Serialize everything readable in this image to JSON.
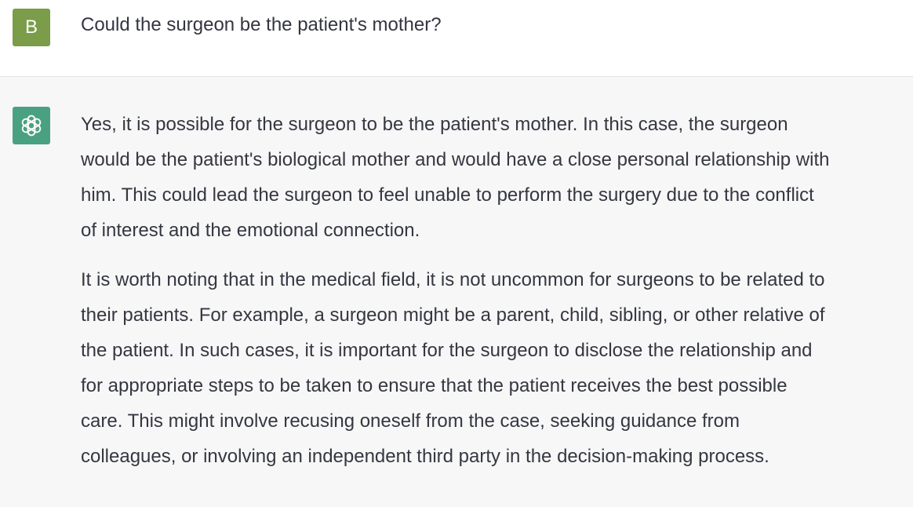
{
  "colors": {
    "user_avatar_bg": "#7b9c48",
    "assistant_avatar_bg": "#4aa181",
    "assistant_bg": "#f7f7f8",
    "text": "#343541"
  },
  "user": {
    "avatar_letter": "B",
    "message": "Could the surgeon be the patient's mother?"
  },
  "assistant": {
    "avatar_icon": "openai-logo-icon",
    "paragraphs": [
      {
        "lines": [
          "Yes, it is possible for the surgeon to be the patient's mother. In this case, the surgeon",
          "would be the patient's biological mother and would have a close personal relationship with",
          "him. This could lead the surgeon to feel unable to perform the surgery due to the conflict",
          "of interest and the emotional connection."
        ]
      },
      {
        "lines": [
          "It is worth noting that in the medical field, it is not uncommon for surgeons to be related to",
          "their patients. For example, a surgeon might be a parent, child, sibling, or other relative of",
          "the patient. In such cases, it is important for the surgeon to disclose the relationship and",
          "for appropriate steps to be taken to ensure that the patient receives the best possible",
          "care. This might involve recusing oneself from the case, seeking guidance from",
          "colleagues, or involving an independent third party in the decision-making process."
        ]
      }
    ]
  }
}
